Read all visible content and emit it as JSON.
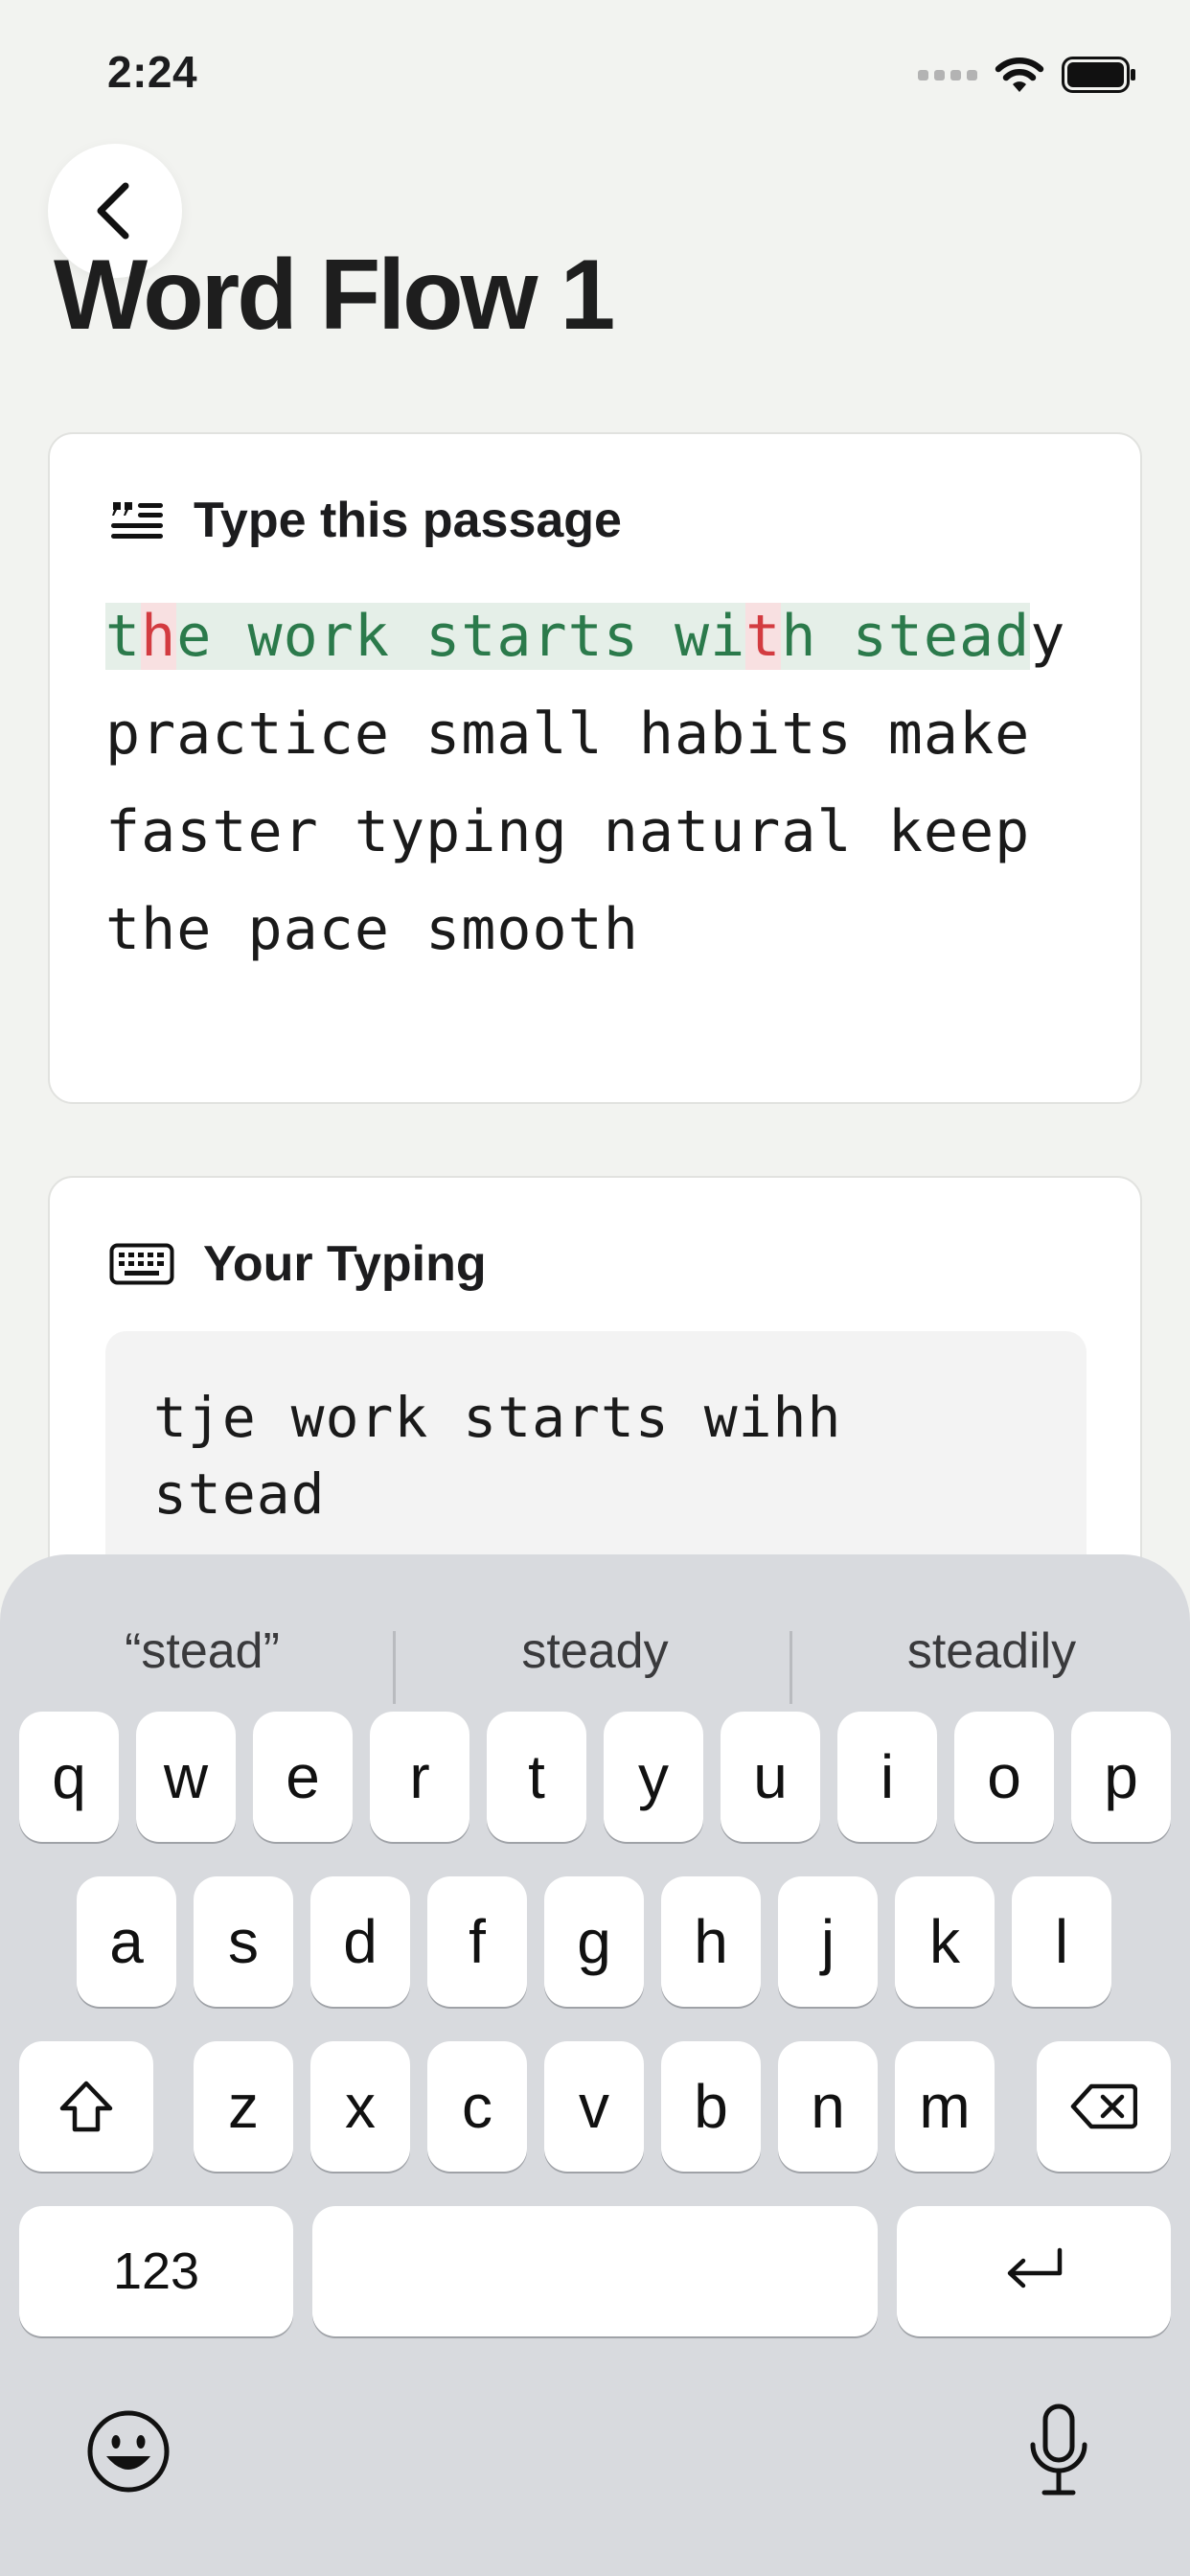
{
  "status_bar": {
    "time": "2:24",
    "icons": [
      "signal-dots-icon",
      "wifi-icon",
      "battery-icon"
    ]
  },
  "header": {
    "back_icon": "chevron-left-icon",
    "title": "Word Flow 1"
  },
  "passage_card": {
    "icon": "quote-lines-icon",
    "label": "Type this passage",
    "segments": [
      {
        "text": "t",
        "state": "correct"
      },
      {
        "text": "h",
        "state": "error"
      },
      {
        "text": "e work starts wi",
        "state": "correct"
      },
      {
        "text": "t",
        "state": "error"
      },
      {
        "text": "h ",
        "state": "correct"
      },
      {
        "text": "stead",
        "state": "correct"
      },
      {
        "text": "y practice small habits make faster typing natural keep the pace smooth",
        "state": "pending"
      }
    ]
  },
  "typing_card": {
    "icon": "keyboard-icon",
    "label": "Your Typing",
    "value": "tje work starts wihh\nstead"
  },
  "keyboard": {
    "suggestions": [
      "“stead”",
      "steady",
      "steadily"
    ],
    "rows": [
      [
        "q",
        "w",
        "e",
        "r",
        "t",
        "y",
        "u",
        "i",
        "o",
        "p"
      ],
      [
        "a",
        "s",
        "d",
        "f",
        "g",
        "h",
        "j",
        "k",
        "l"
      ],
      [
        "z",
        "x",
        "c",
        "v",
        "b",
        "n",
        "m"
      ]
    ],
    "numbers_label": "123",
    "icons": {
      "shift": "shift-icon",
      "delete": "delete-icon",
      "return": "return-icon",
      "emoji": "emoji-icon",
      "dictation": "microphone-icon"
    }
  },
  "colors": {
    "correct_text": "#2b7a4b",
    "correct_bg": "#e5efe8",
    "error_text": "#d33b40",
    "error_bg": "#f8e0e1",
    "background": "#f2f3f0",
    "keyboard_bg": "#d8dade"
  }
}
